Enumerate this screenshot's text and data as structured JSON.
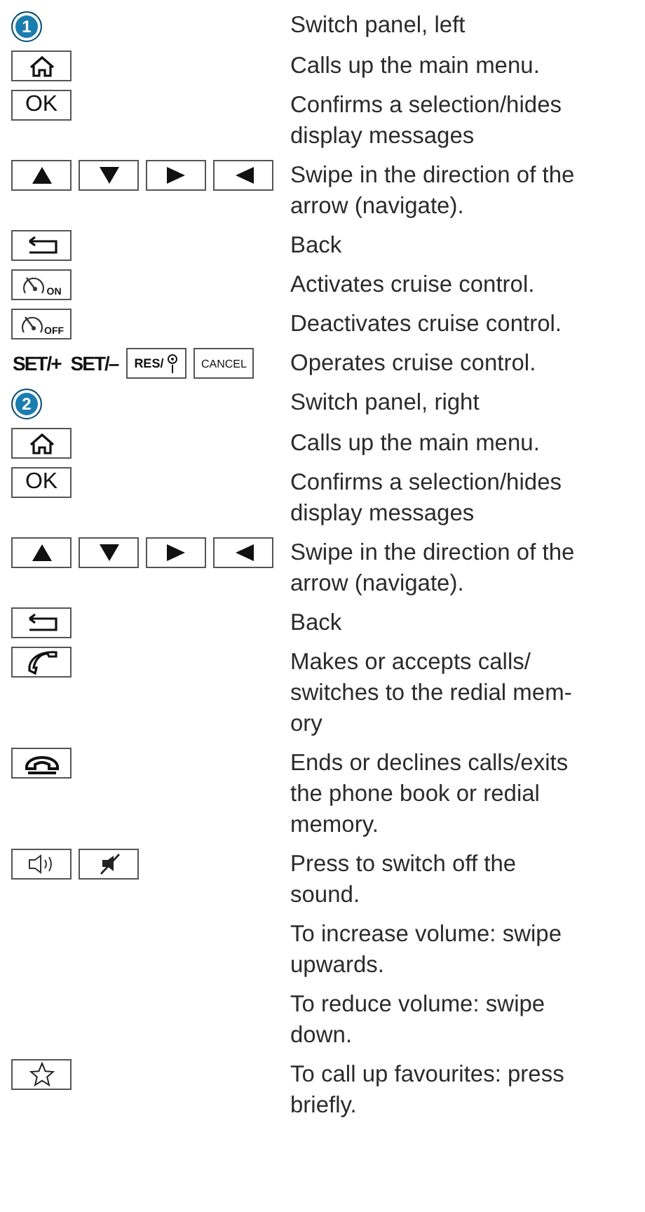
{
  "rows": [
    {
      "keys": [
        {
          "kind": "badge",
          "label": "1"
        }
      ],
      "text": "Switch panel, left"
    },
    {
      "keys": [
        {
          "kind": "home"
        }
      ],
      "text": "Calls up the main menu."
    },
    {
      "keys": [
        {
          "kind": "label",
          "label": "OK"
        }
      ],
      "text": "Confirms a selection/hides\ndisplay messages"
    },
    {
      "keys": [
        {
          "kind": "up"
        },
        {
          "kind": "down"
        },
        {
          "kind": "right"
        },
        {
          "kind": "left"
        }
      ],
      "text": "Swipe in the direction of the\narrow (navigate)."
    },
    {
      "keys": [
        {
          "kind": "back"
        }
      ],
      "text": "Back"
    },
    {
      "keys": [
        {
          "kind": "cruise",
          "label": "ON"
        }
      ],
      "text": "Activates cruise control."
    },
    {
      "keys": [
        {
          "kind": "cruise",
          "label": "OFF"
        }
      ],
      "text": "Deactivates cruise control."
    },
    {
      "keys": [
        {
          "kind": "bold",
          "label": "SET/+"
        },
        {
          "kind": "bold",
          "label": "SET/–"
        },
        {
          "kind": "res",
          "label": "RES/"
        },
        {
          "kind": "small",
          "label": "CANCEL"
        }
      ],
      "text": "Operates cruise control."
    },
    {
      "keys": [
        {
          "kind": "badge",
          "label": "2"
        }
      ],
      "text": "Switch panel, right"
    },
    {
      "keys": [
        {
          "kind": "home"
        }
      ],
      "text": "Calls up the main menu."
    },
    {
      "keys": [
        {
          "kind": "label",
          "label": "OK"
        }
      ],
      "text": "Confirms a selection/hides\ndisplay messages"
    },
    {
      "keys": [
        {
          "kind": "up"
        },
        {
          "kind": "down"
        },
        {
          "kind": "right"
        },
        {
          "kind": "left"
        }
      ],
      "text": "Swipe in the direction of the\narrow (navigate)."
    },
    {
      "keys": [
        {
          "kind": "back"
        }
      ],
      "text": "Back"
    },
    {
      "keys": [
        {
          "kind": "phone"
        }
      ],
      "text": "Makes or accepts calls/\nswitches to the redial mem-\nory"
    },
    {
      "keys": [
        {
          "kind": "hangup"
        }
      ],
      "text": "Ends or declines calls/exits\nthe phone book or redial\nmemory."
    },
    {
      "keys": [
        {
          "kind": "speaker"
        },
        {
          "kind": "mute"
        }
      ],
      "text": "Press to switch off the\nsound."
    },
    {
      "keys": [],
      "text": "To increase volume: swipe\nupwards."
    },
    {
      "keys": [],
      "text": "To reduce volume: swipe\ndown."
    },
    {
      "keys": [
        {
          "kind": "star"
        }
      ],
      "text": "To call up favourites: press\nbriefly."
    }
  ]
}
